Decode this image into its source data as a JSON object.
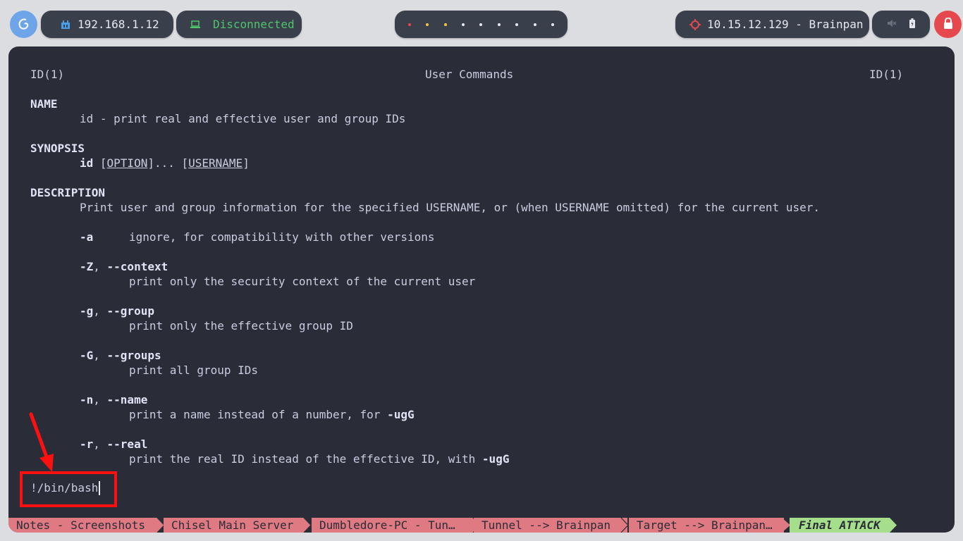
{
  "topbar": {
    "ip": "192.168.1.12",
    "vpn_status": "Disconnected",
    "workspace_dot_colors": [
      "#e5484d",
      "#f5c542",
      "#f5c542",
      "#e6e9ef",
      "#e6e9ef",
      "#e6e9ef",
      "#e6e9ef",
      "#e6e9ef",
      "#e6e9ef"
    ],
    "target": "10.15.12.129 - Brainpan"
  },
  "man": {
    "header_left": "ID(1)",
    "header_center": "User Commands",
    "header_right": "ID(1)",
    "name_heading": "NAME",
    "name_text": "id - print real and effective user and group IDs",
    "synopsis_heading": "SYNOPSIS",
    "synopsis_cmd": "id",
    "synopsis_option": "OPTION",
    "synopsis_username": "USERNAME",
    "description_heading": "DESCRIPTION",
    "description_text": "Print user and group information for the specified USERNAME, or (when USERNAME omitted) for the current user.",
    "options": [
      {
        "flag": "-a",
        "desc": "ignore, for compatibility with other versions"
      },
      {
        "flag": "-Z",
        "long": "--context",
        "desc": "print only the security context of the current user"
      },
      {
        "flag": "-g",
        "long": "--group",
        "desc": "print only the effective group ID"
      },
      {
        "flag": "-G",
        "long": "--groups",
        "desc": "print all group IDs"
      },
      {
        "flag": "-n",
        "long": "--name",
        "desc": "print a name instead of a number, for",
        "desc_flag": "-ugG"
      },
      {
        "flag": "-r",
        "long": "--real",
        "desc": "print the real ID instead of the effective ID, with",
        "desc_flag": "-ugG"
      }
    ]
  },
  "prompt": {
    "command": "!/bin/bash"
  },
  "tabs": [
    {
      "label": "Notes - Screenshots"
    },
    {
      "label": "Chisel Main Server"
    },
    {
      "label": "Dumbledore-PC - Tun…"
    },
    {
      "label": "Tunnel --> Brainpan"
    },
    {
      "label": "Target --> Brainpan…"
    },
    {
      "label": "Final ATTACK"
    }
  ],
  "colors": {
    "terminal_bg": "#2a2c37",
    "tab_inactive": "#e07a82",
    "tab_active": "#a6df8c",
    "vpn_status": "#4fc46a",
    "target_icon": "#e5484d",
    "annotation": "#ff1010"
  }
}
